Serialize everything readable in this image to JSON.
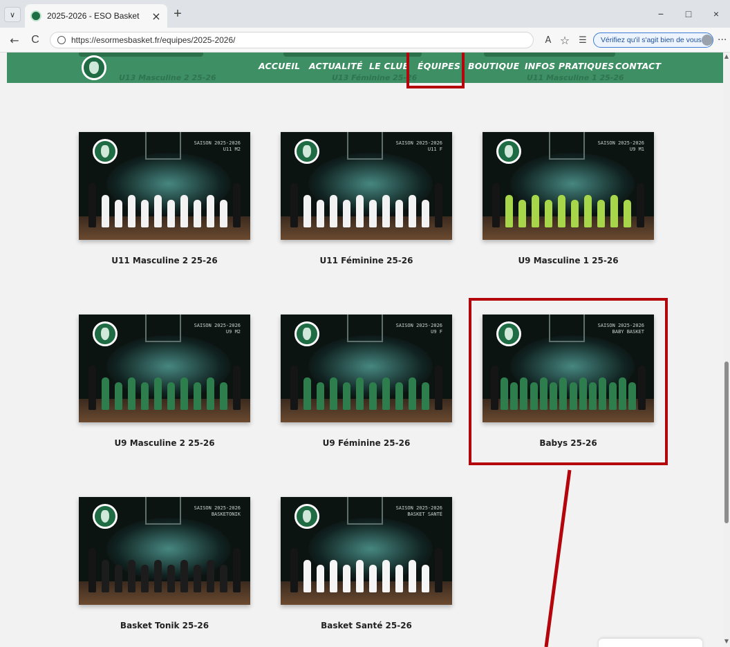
{
  "browser": {
    "tab_title": "2025-2026 - ESO Basket",
    "tab_close": "×",
    "new_tab": "+",
    "url": "https://esormesbasket.fr/equipes/2025-2026/",
    "verify_text": "Vérifiez qu'il s'agit bien de vous",
    "window_controls": {
      "minimize": "−",
      "maximize": "□",
      "close": "×"
    },
    "icons": [
      "tab-list-icon",
      "back-icon",
      "refresh-icon",
      "lock-icon",
      "read-aloud-icon",
      "favorite-icon",
      "favorites-bar-icon",
      "profile-icon",
      "more-icon"
    ],
    "glyphs": {
      "tab_list": "∨",
      "back": "←",
      "refresh": "C",
      "read_aloud": "A",
      "favorite": "☆",
      "favorites_bar": "☰",
      "more": "···"
    }
  },
  "site": {
    "nav": [
      "ACCUEIL",
      "ACTUALITÉ",
      "LE CLUB",
      "ÉQUIPES",
      "BOUTIQUE",
      "INFOS PRATIQUES",
      "CONTACT"
    ],
    "active_nav": "ÉQUIPES",
    "behind_header": [
      "U13 Masculine 2 25-26",
      "U13 Féminine 25-26",
      "U11 Masculine 1 25-26"
    ],
    "accent_color": "#3e8f63",
    "highlight_color": "#b3050b"
  },
  "teams": [
    {
      "name": "U11 Masculine 2 25-26",
      "season": "SAISON 2025-2026",
      "category": "U11 M2",
      "jersey": "#f2f2f2"
    },
    {
      "name": "U11 Féminine 25-26",
      "season": "SAISON 2025-2026",
      "category": "U11 F",
      "jersey": "#f2f2f2"
    },
    {
      "name": "U9 Masculine 1 25-26",
      "season": "SAISON 2025-2026",
      "category": "U9 M1",
      "jersey": "#a7d64a"
    },
    {
      "name": "U9 Masculine 2 25-26",
      "season": "SAISON 2025-2026",
      "category": "U9 M2",
      "jersey": "#2d7d4d"
    },
    {
      "name": "U9 Féminine 25-26",
      "season": "SAISON 2025-2026",
      "category": "U9 F",
      "jersey": "#2d7d4d"
    },
    {
      "name": "Babys 25-26",
      "season": "SAISON 2025-2026",
      "category": "BABY BASKET",
      "jersey": "#2d7d4d"
    },
    {
      "name": "Basket Tonik 25-26",
      "season": "SAISON 2025-2026",
      "category": "BASKETONIK",
      "jersey": "#1c1c1c"
    },
    {
      "name": "Basket Santé 25-26",
      "season": "SAISON 2025-2026",
      "category": "BASKET SANTÉ",
      "jersey": "#f5f5f5"
    }
  ],
  "highlighted_team": "Babys 25-26"
}
